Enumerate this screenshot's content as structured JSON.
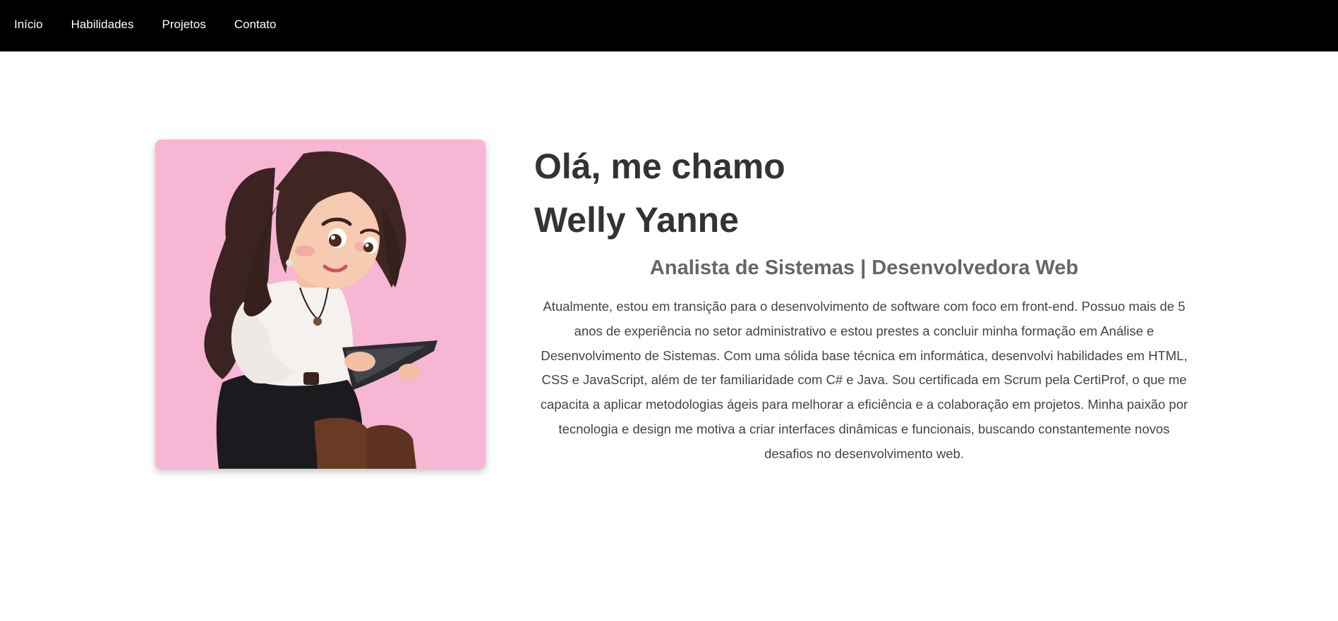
{
  "nav": {
    "items": [
      {
        "label": "Início"
      },
      {
        "label": "Habilidades"
      },
      {
        "label": "Projetos"
      },
      {
        "label": "Contato"
      }
    ]
  },
  "hero": {
    "greeting_line1": "Olá, me chamo",
    "greeting_line2": "Welly Yanne",
    "role": "Analista de Sistemas | Desenvolvedora Web",
    "bio": "Atualmente, estou em transição para o desenvolvimento de software com foco em front-end. Possuo mais de 5 anos de experiência no setor administrativo e estou prestes a concluir minha formação em Análise e Desenvolvimento de Sistemas. Com uma sólida base técnica em informática, desenvolvi habilidades em HTML, CSS e JavaScript, além de ter familiaridade com C# e Java. Sou certificada em Scrum pela CertiProf, o que me capacita a aplicar metodologias ágeis para melhorar a eficiência e a colaboração em projetos. Minha paixão por tecnologia e design me motiva a criar interfaces dinâmicas e funcionais, buscando constantemente novos desafios no desenvolvimento web."
  },
  "colors": {
    "navbar_bg": "#000000",
    "nav_text": "#ffffff",
    "heading": "#333333",
    "role": "#666666",
    "portrait_bg": "#f7b6d4"
  }
}
